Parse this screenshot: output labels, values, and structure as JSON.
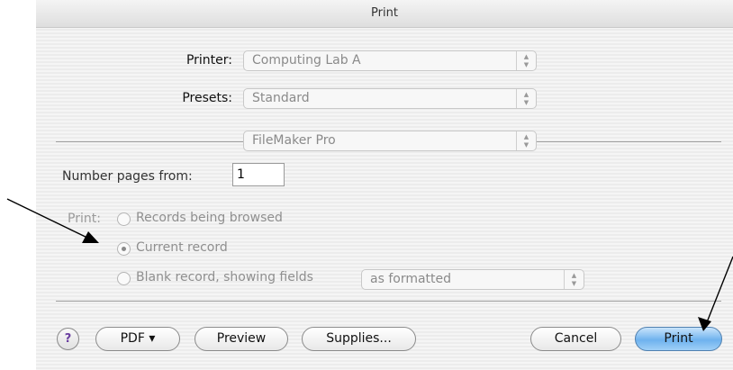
{
  "window": {
    "title": "Print"
  },
  "printer": {
    "label": "Printer:",
    "value": "Computing Lab A"
  },
  "presets": {
    "label": "Presets:",
    "value": "Standard"
  },
  "section": {
    "value": "FileMaker Pro"
  },
  "number_pages": {
    "label": "Number pages from:",
    "value": "1"
  },
  "print_options": {
    "label": "Print:",
    "options": [
      {
        "label": "Records being browsed",
        "selected": false
      },
      {
        "label": "Current record",
        "selected": true
      },
      {
        "label": "Blank record, showing fields",
        "selected": false
      }
    ],
    "format_value": "as formatted"
  },
  "buttons": {
    "help": "?",
    "pdf": "PDF ▾",
    "preview": "Preview",
    "supplies": "Supplies...",
    "cancel": "Cancel",
    "print": "Print"
  },
  "icons": {
    "stepper": "up-down-arrows",
    "help": "question-mark",
    "annotation": "black-arrow"
  },
  "colors": {
    "default_button": "#6eb2ee",
    "help_glyph": "#6a3fa0"
  }
}
